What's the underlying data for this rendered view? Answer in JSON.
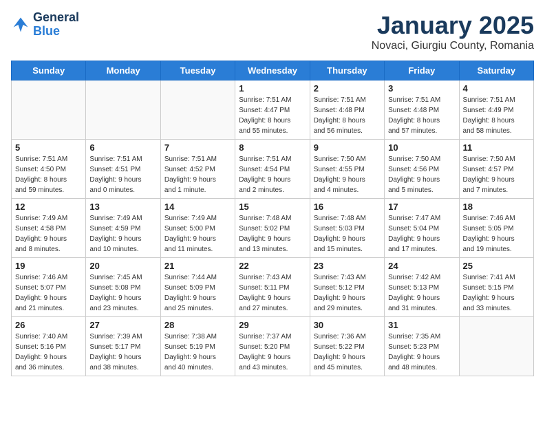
{
  "logo": {
    "line1": "General",
    "line2": "Blue"
  },
  "title": "January 2025",
  "subtitle": "Novaci, Giurgiu County, Romania",
  "weekdays": [
    "Sunday",
    "Monday",
    "Tuesday",
    "Wednesday",
    "Thursday",
    "Friday",
    "Saturday"
  ],
  "weeks": [
    [
      {
        "day": "",
        "info": ""
      },
      {
        "day": "",
        "info": ""
      },
      {
        "day": "",
        "info": ""
      },
      {
        "day": "1",
        "info": "Sunrise: 7:51 AM\nSunset: 4:47 PM\nDaylight: 8 hours\nand 55 minutes."
      },
      {
        "day": "2",
        "info": "Sunrise: 7:51 AM\nSunset: 4:48 PM\nDaylight: 8 hours\nand 56 minutes."
      },
      {
        "day": "3",
        "info": "Sunrise: 7:51 AM\nSunset: 4:48 PM\nDaylight: 8 hours\nand 57 minutes."
      },
      {
        "day": "4",
        "info": "Sunrise: 7:51 AM\nSunset: 4:49 PM\nDaylight: 8 hours\nand 58 minutes."
      }
    ],
    [
      {
        "day": "5",
        "info": "Sunrise: 7:51 AM\nSunset: 4:50 PM\nDaylight: 8 hours\nand 59 minutes."
      },
      {
        "day": "6",
        "info": "Sunrise: 7:51 AM\nSunset: 4:51 PM\nDaylight: 9 hours\nand 0 minutes."
      },
      {
        "day": "7",
        "info": "Sunrise: 7:51 AM\nSunset: 4:52 PM\nDaylight: 9 hours\nand 1 minute."
      },
      {
        "day": "8",
        "info": "Sunrise: 7:51 AM\nSunset: 4:54 PM\nDaylight: 9 hours\nand 2 minutes."
      },
      {
        "day": "9",
        "info": "Sunrise: 7:50 AM\nSunset: 4:55 PM\nDaylight: 9 hours\nand 4 minutes."
      },
      {
        "day": "10",
        "info": "Sunrise: 7:50 AM\nSunset: 4:56 PM\nDaylight: 9 hours\nand 5 minutes."
      },
      {
        "day": "11",
        "info": "Sunrise: 7:50 AM\nSunset: 4:57 PM\nDaylight: 9 hours\nand 7 minutes."
      }
    ],
    [
      {
        "day": "12",
        "info": "Sunrise: 7:49 AM\nSunset: 4:58 PM\nDaylight: 9 hours\nand 8 minutes."
      },
      {
        "day": "13",
        "info": "Sunrise: 7:49 AM\nSunset: 4:59 PM\nDaylight: 9 hours\nand 10 minutes."
      },
      {
        "day": "14",
        "info": "Sunrise: 7:49 AM\nSunset: 5:00 PM\nDaylight: 9 hours\nand 11 minutes."
      },
      {
        "day": "15",
        "info": "Sunrise: 7:48 AM\nSunset: 5:02 PM\nDaylight: 9 hours\nand 13 minutes."
      },
      {
        "day": "16",
        "info": "Sunrise: 7:48 AM\nSunset: 5:03 PM\nDaylight: 9 hours\nand 15 minutes."
      },
      {
        "day": "17",
        "info": "Sunrise: 7:47 AM\nSunset: 5:04 PM\nDaylight: 9 hours\nand 17 minutes."
      },
      {
        "day": "18",
        "info": "Sunrise: 7:46 AM\nSunset: 5:05 PM\nDaylight: 9 hours\nand 19 minutes."
      }
    ],
    [
      {
        "day": "19",
        "info": "Sunrise: 7:46 AM\nSunset: 5:07 PM\nDaylight: 9 hours\nand 21 minutes."
      },
      {
        "day": "20",
        "info": "Sunrise: 7:45 AM\nSunset: 5:08 PM\nDaylight: 9 hours\nand 23 minutes."
      },
      {
        "day": "21",
        "info": "Sunrise: 7:44 AM\nSunset: 5:09 PM\nDaylight: 9 hours\nand 25 minutes."
      },
      {
        "day": "22",
        "info": "Sunrise: 7:43 AM\nSunset: 5:11 PM\nDaylight: 9 hours\nand 27 minutes."
      },
      {
        "day": "23",
        "info": "Sunrise: 7:43 AM\nSunset: 5:12 PM\nDaylight: 9 hours\nand 29 minutes."
      },
      {
        "day": "24",
        "info": "Sunrise: 7:42 AM\nSunset: 5:13 PM\nDaylight: 9 hours\nand 31 minutes."
      },
      {
        "day": "25",
        "info": "Sunrise: 7:41 AM\nSunset: 5:15 PM\nDaylight: 9 hours\nand 33 minutes."
      }
    ],
    [
      {
        "day": "26",
        "info": "Sunrise: 7:40 AM\nSunset: 5:16 PM\nDaylight: 9 hours\nand 36 minutes."
      },
      {
        "day": "27",
        "info": "Sunrise: 7:39 AM\nSunset: 5:17 PM\nDaylight: 9 hours\nand 38 minutes."
      },
      {
        "day": "28",
        "info": "Sunrise: 7:38 AM\nSunset: 5:19 PM\nDaylight: 9 hours\nand 40 minutes."
      },
      {
        "day": "29",
        "info": "Sunrise: 7:37 AM\nSunset: 5:20 PM\nDaylight: 9 hours\nand 43 minutes."
      },
      {
        "day": "30",
        "info": "Sunrise: 7:36 AM\nSunset: 5:22 PM\nDaylight: 9 hours\nand 45 minutes."
      },
      {
        "day": "31",
        "info": "Sunrise: 7:35 AM\nSunset: 5:23 PM\nDaylight: 9 hours\nand 48 minutes."
      },
      {
        "day": "",
        "info": ""
      }
    ]
  ]
}
